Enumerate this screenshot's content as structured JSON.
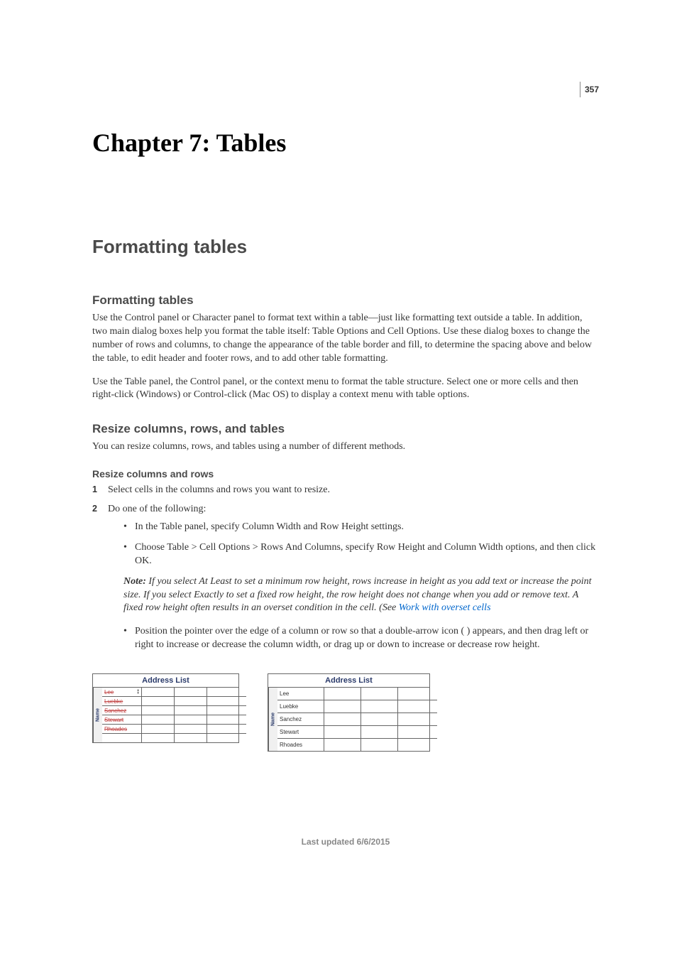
{
  "page_number": "357",
  "chapter_title": "Chapter 7: Tables",
  "section_title": "Formatting tables",
  "sub1": {
    "heading": "Formatting tables",
    "p1": "Use the Control panel or Character panel to format text within a table—just like formatting text outside a table. In addition, two main dialog boxes help you format the table itself: Table Options and Cell Options. Use these dialog boxes to change the number of rows and columns, to change the appearance of the table border and fill, to determine the spacing above and below the table, to edit header and footer rows, and to add other table formatting.",
    "p2": "Use the Table panel, the Control panel, or the context menu to format the table structure. Select one or more cells and then right-click (Windows) or Control-click (Mac OS) to display a context menu with table options."
  },
  "sub2": {
    "heading": "Resize columns, rows, and tables",
    "p1": "You can resize columns, rows, and tables using a number of different methods."
  },
  "sub3": {
    "heading": "Resize columns and rows",
    "step1": "Select cells in the columns and rows you want to resize.",
    "step2": "Do one of the following:",
    "bullet1": "In the Table panel, specify Column Width and Row Height settings.",
    "bullet2": "Choose Table > Cell Options > Rows And Columns, specify Row Height and Column Width options, and then click OK.",
    "note_label": "Note: ",
    "note_text_a": "If you select At Least to set a minimum row height, rows increase in height as you add text or increase the point size. If you select Exactly to set a fixed row height, the row height does not change when you add or remove text. A fixed row height often results in an overset condition in the cell. (See ",
    "note_link": "Work with overset cells",
    "bullet3": "Position the pointer over the edge of a column or row so that a double-arrow icon ( ) appears, and then drag left or right to increase or decrease the column width, or drag up or down to increase or decrease row height."
  },
  "illustration": {
    "header": "Address List",
    "side": "Name",
    "names": [
      "Lee",
      "Luebke",
      "Sanchez",
      "Stewart",
      "Rhoades"
    ]
  },
  "footer": "Last updated 6/6/2015"
}
